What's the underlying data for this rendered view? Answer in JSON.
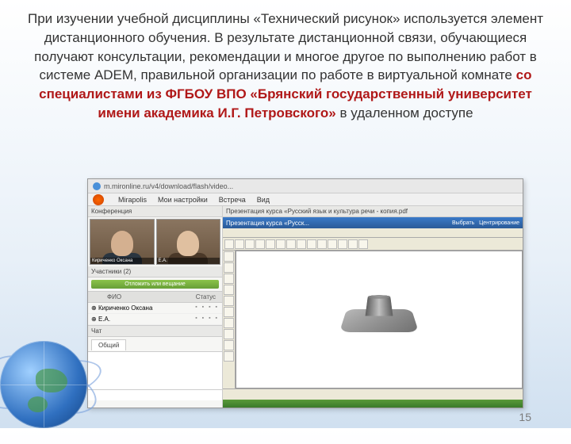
{
  "text": {
    "p1": "При изучении учебной дисциплины «Технический рисунок» используется элемент дистанционного обучения. В результате дистанционной связи, обучающиеся получают консультации, рекомендации и многое другое по выполнению работ в системе ADEM, правильной организации по работе в виртуальной комнате",
    "p2": "со специалистами из ФГБОУ ВПО «Брянский государственный университет имени академика И.Г. Петровского»",
    "p3": "в удаленном доступе"
  },
  "browser": {
    "url": "m.mironline.ru/v4/download/flash/video..."
  },
  "menu": {
    "brand": "Mirapolis",
    "item1": "Мои настройки",
    "item2": "Встреча",
    "item3": "Вид"
  },
  "leftPanel": {
    "conference": "Конференция",
    "participants": "Участники (2)",
    "greenBtn": "Отложить или вещание",
    "colFio": "ФИО",
    "colStatus": "Статус",
    "user1": "Кириченко Оксана",
    "user2": "Е.А.",
    "chat": "Чат",
    "chatTab": "Общий"
  },
  "cad": {
    "title": "Презентация курса «Русский язык и культура речи - копия.pdf",
    "tabText": "Презентация курса «Русск...",
    "btn1": "Выбрать",
    "btn2": "Центрирование"
  },
  "pageNum": "15"
}
